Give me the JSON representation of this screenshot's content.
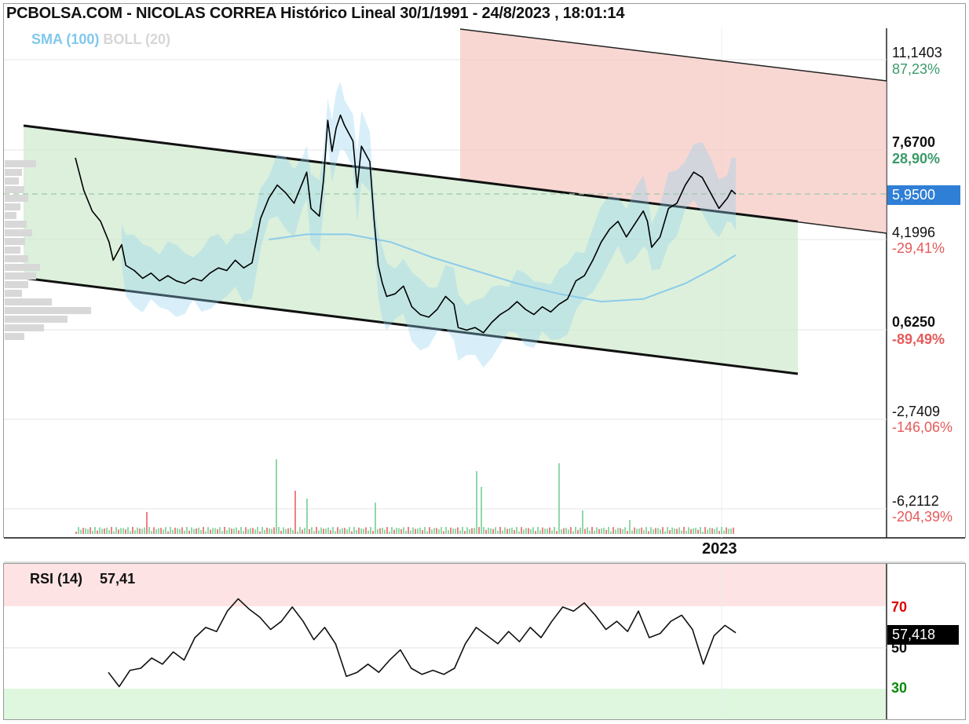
{
  "title": "PCBOLSA.COM - NICOLAS CORREA Histórico Lineal 30/1/1991 - 24/8/2023 , 18:01:14",
  "legend": {
    "sma": "SMA (100)",
    "boll": "BOLL (20)"
  },
  "axis_year": "2023",
  "colors": {
    "price_line": "#000000",
    "sma": "#8ccbea",
    "boll_band": "#8fd0f2",
    "channel_fill": "#d9efd9",
    "resistance_fill": "#f6c9c4",
    "rsi_overbought": "#fde3e3",
    "rsi_oversold": "#def7de",
    "positive": "#3a9a6a",
    "negative": "#e55a5a",
    "current_price_box": "#2f7fd6"
  },
  "price_scale": [
    {
      "value": "11,1403",
      "pct": "87,23%",
      "bold": false,
      "pct_class": "pos"
    },
    {
      "value": "7,6700",
      "pct": "28,90%",
      "bold": true,
      "pct_class": "pos"
    },
    {
      "value": "4,1996",
      "pct": "-29,41%",
      "bold": false,
      "pct_class": "neg"
    },
    {
      "value": "0,6250",
      "pct": "-89,49%",
      "bold": true,
      "pct_class": "neg"
    },
    {
      "value": "-2,7409",
      "pct": "-146,06%",
      "bold": false,
      "pct_class": "neg"
    },
    {
      "value": "-6,2112",
      "pct": "-204,39%",
      "bold": false,
      "pct_class": "neg"
    }
  ],
  "current_price": "5,9500",
  "rsi": {
    "label": "RSI (14)",
    "value_label": "57,41",
    "current": "57,418",
    "levels": [
      "70",
      "50",
      "30"
    ]
  },
  "chart_data": [
    {
      "type": "line",
      "title": "PCBOLSA.COM - NICOLAS CORREA Histórico Lineal 30/1/1991 - 24/8/2023 , 18:01:14",
      "ylim": [
        -7.5,
        12.5
      ],
      "series": [
        {
          "name": "",
          "points": [
            [
              0,
              7.35
            ],
            [
              2,
              6.1
            ],
            [
              4,
              5.3
            ],
            [
              6,
              4.9
            ],
            [
              8,
              4.1
            ],
            [
              9,
              3.4
            ],
            [
              11,
              4.0
            ],
            [
              12,
              3.2
            ],
            [
              14,
              3.0
            ],
            [
              16,
              2.7
            ],
            [
              18,
              2.9
            ],
            [
              20,
              2.6
            ],
            [
              22,
              2.8
            ],
            [
              24,
              2.6
            ],
            [
              26,
              2.5
            ],
            [
              28,
              2.7
            ],
            [
              30,
              2.6
            ],
            [
              32,
              2.9
            ],
            [
              34,
              3.1
            ],
            [
              36,
              3.0
            ],
            [
              38,
              3.4
            ],
            [
              40,
              3.1
            ],
            [
              42,
              3.3
            ],
            [
              44,
              5.0
            ],
            [
              46,
              5.8
            ],
            [
              48,
              6.3
            ],
            [
              50,
              6.0
            ],
            [
              52,
              5.6
            ],
            [
              54,
              6.4
            ],
            [
              55,
              6.8
            ],
            [
              56,
              5.4
            ],
            [
              58,
              5.1
            ],
            [
              59,
              6.5
            ],
            [
              60,
              8.8
            ],
            [
              61,
              7.6
            ],
            [
              62,
              8.5
            ],
            [
              63,
              9.0
            ],
            [
              64,
              8.6
            ],
            [
              66,
              8.0
            ],
            [
              67,
              6.2
            ],
            [
              68,
              7.8
            ],
            [
              70,
              7.2
            ],
            [
              71,
              5.0
            ],
            [
              72,
              3.2
            ],
            [
              73,
              2.5
            ],
            [
              74,
              2.0
            ],
            [
              76,
              2.1
            ],
            [
              78,
              2.4
            ],
            [
              80,
              1.6
            ],
            [
              82,
              1.3
            ],
            [
              84,
              1.2
            ],
            [
              86,
              1.5
            ],
            [
              88,
              2.0
            ],
            [
              90,
              1.7
            ],
            [
              91,
              0.8
            ],
            [
              93,
              0.7
            ],
            [
              95,
              0.8
            ],
            [
              97,
              0.6
            ],
            [
              99,
              1.0
            ],
            [
              101,
              1.3
            ],
            [
              103,
              1.5
            ],
            [
              105,
              1.8
            ],
            [
              107,
              1.5
            ],
            [
              109,
              1.3
            ],
            [
              111,
              1.6
            ],
            [
              113,
              1.4
            ],
            [
              115,
              1.7
            ],
            [
              117,
              1.9
            ],
            [
              119,
              2.6
            ],
            [
              121,
              2.8
            ],
            [
              123,
              3.4
            ],
            [
              125,
              4.1
            ],
            [
              127,
              4.6
            ],
            [
              129,
              4.9
            ],
            [
              131,
              4.3
            ],
            [
              133,
              4.8
            ],
            [
              135,
              5.3
            ],
            [
              136,
              4.9
            ],
            [
              137,
              3.9
            ],
            [
              139,
              4.3
            ],
            [
              141,
              5.4
            ],
            [
              143,
              5.6
            ],
            [
              145,
              6.3
            ],
            [
              147,
              6.8
            ],
            [
              149,
              6.6
            ],
            [
              151,
              6.0
            ],
            [
              153,
              5.4
            ],
            [
              155,
              5.8
            ],
            [
              156,
              6.1
            ],
            [
              157,
              5.95
            ]
          ]
        },
        {
          "name": "SMA (100)",
          "points": [
            [
              46,
              4.2
            ],
            [
              55,
              4.4
            ],
            [
              65,
              4.4
            ],
            [
              75,
              4.1
            ],
            [
              85,
              3.5
            ],
            [
              95,
              3.0
            ],
            [
              105,
              2.5
            ],
            [
              115,
              2.1
            ],
            [
              125,
              1.8
            ],
            [
              135,
              1.9
            ],
            [
              145,
              2.5
            ],
            [
              152,
              3.1
            ],
            [
              157,
              3.6
            ]
          ]
        }
      ]
    },
    {
      "type": "line",
      "title": "RSI (14)",
      "ylim": [
        20,
        80
      ],
      "series": [
        {
          "name": "RSI (14)",
          "points": [
            [
              0,
              38
            ],
            [
              2,
              31
            ],
            [
              4,
              39
            ],
            [
              6,
              40
            ],
            [
              8,
              45
            ],
            [
              10,
              42
            ],
            [
              12,
              48
            ],
            [
              14,
              44
            ],
            [
              16,
              55
            ],
            [
              18,
              60
            ],
            [
              20,
              58
            ],
            [
              22,
              68
            ],
            [
              24,
              74
            ],
            [
              26,
              69
            ],
            [
              28,
              65
            ],
            [
              30,
              59
            ],
            [
              32,
              63
            ],
            [
              34,
              70
            ],
            [
              36,
              63
            ],
            [
              38,
              54
            ],
            [
              40,
              60
            ],
            [
              42,
              52
            ],
            [
              44,
              36
            ],
            [
              46,
              38
            ],
            [
              48,
              42
            ],
            [
              50,
              38
            ],
            [
              52,
              44
            ],
            [
              54,
              49
            ],
            [
              56,
              40
            ],
            [
              58,
              37
            ],
            [
              60,
              39
            ],
            [
              62,
              37
            ],
            [
              64,
              40
            ],
            [
              66,
              52
            ],
            [
              68,
              60
            ],
            [
              70,
              56
            ],
            [
              72,
              52
            ],
            [
              74,
              58
            ],
            [
              76,
              53
            ],
            [
              78,
              60
            ],
            [
              80,
              55
            ],
            [
              82,
              63
            ],
            [
              84,
              70
            ],
            [
              86,
              68
            ],
            [
              88,
              72
            ],
            [
              90,
              66
            ],
            [
              92,
              59
            ],
            [
              94,
              63
            ],
            [
              96,
              58
            ],
            [
              98,
              68
            ],
            [
              100,
              55
            ],
            [
              102,
              57
            ],
            [
              104,
              63
            ],
            [
              106,
              66
            ],
            [
              108,
              59
            ],
            [
              110,
              42
            ],
            [
              112,
              56
            ],
            [
              114,
              61
            ],
            [
              116,
              57.4
            ]
          ]
        }
      ]
    }
  ]
}
